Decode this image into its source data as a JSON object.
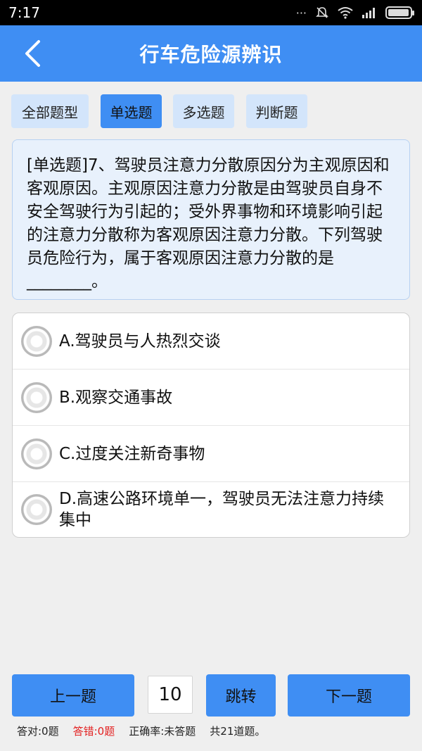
{
  "status_bar": {
    "time": "7:17",
    "icons": [
      "dots-icon",
      "mute-icon",
      "wifi-icon",
      "signal-icon",
      "battery-icon"
    ]
  },
  "header": {
    "title": "行车危险源辨识",
    "back_icon": "chevron-left-icon"
  },
  "type_tabs": [
    {
      "label": "全部题型",
      "active": false
    },
    {
      "label": "单选题",
      "active": true
    },
    {
      "label": "多选题",
      "active": false
    },
    {
      "label": "判断题",
      "active": false
    }
  ],
  "question": {
    "text": "[单选题]7、驾驶员注意力分散原因分为主观原因和客观原因。主观原因注意力分散是由驾驶员自身不安全驾驶行为引起的；受外界事物和环境影响引起的注意力分散称为客观原因注意力分散。下列驾驶员危险行为，属于客观原因注意力分散的是________。"
  },
  "options": [
    {
      "label": "A.驾驶员与人热烈交谈",
      "selected": false
    },
    {
      "label": "B.观察交通事故",
      "selected": false
    },
    {
      "label": "C.过度关注新奇事物",
      "selected": false
    },
    {
      "label": "D.高速公路环境单一，驾驶员无法注意力持续集中",
      "selected": false
    }
  ],
  "navigation": {
    "prev_label": "上一题",
    "page_value": "10",
    "jump_label": "跳转",
    "next_label": "下一题"
  },
  "stats": {
    "correct": "答对:0题",
    "wrong": "答错:0题",
    "accuracy": "正确率:未答题",
    "total": "共21道题。"
  },
  "colors": {
    "primary": "#3f8ef3",
    "tab_inactive": "#d3e5fb",
    "wrong_text": "#e32020"
  }
}
